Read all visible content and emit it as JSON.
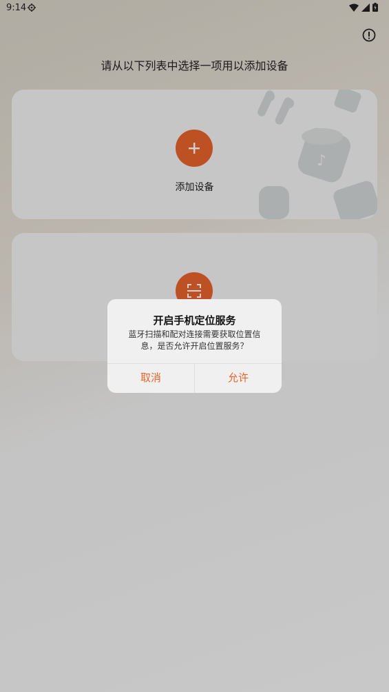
{
  "status_bar": {
    "time": "9:14",
    "icons": [
      "settings-icon",
      "wifi-icon",
      "cellular-icon",
      "battery-icon"
    ]
  },
  "header": {
    "info_icon": "info-icon"
  },
  "page": {
    "heading": "请从以下列表中选择一项用以添加设备"
  },
  "cards": [
    {
      "label": "添加设备",
      "icon": "plus-icon"
    },
    {
      "label": "",
      "icon": "scan-icon"
    }
  ],
  "dialog": {
    "title": "开启手机定位服务",
    "message": "蓝牙扫描和配对连接需要获取位置信息，是否允许开启位置服务？",
    "cancel": "取消",
    "confirm": "允许"
  },
  "colors": {
    "accent": "#e8632b",
    "card_bg": "#f2f2f2",
    "dialog_bg": "#f0f0f0"
  }
}
